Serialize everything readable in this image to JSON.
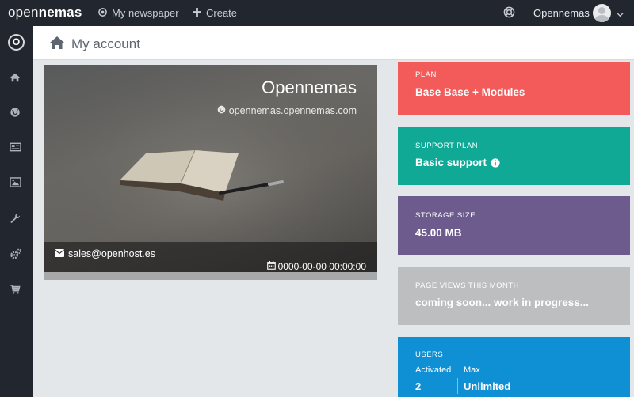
{
  "topbar": {
    "logo_thin": "open",
    "logo_bold": "nemas",
    "nav_newspaper": "My newspaper",
    "nav_create": "Create",
    "user_name": "Opennemas"
  },
  "sidebar": {
    "logo_letter": "O",
    "icons": [
      "home-icon",
      "globe-icon",
      "newspaper-icon",
      "image-icon",
      "wrench-icon",
      "cogs-icon",
      "cart-icon"
    ]
  },
  "header": {
    "title": "My account"
  },
  "hero": {
    "title": "Opennemas",
    "domain": "opennemas.opennemas.com",
    "email": "sales@openhost.es",
    "date": "0000-00-00 00:00:00"
  },
  "cards": {
    "plan": {
      "label": "PLAN",
      "value": "Base Base + Modules",
      "color": "#f35a5a"
    },
    "support": {
      "label": "SUPPORT PLAN",
      "value": "Basic support",
      "color": "#10a996"
    },
    "storage": {
      "label": "STORAGE SIZE",
      "value": "45.00 MB",
      "color": "#6c5b8c"
    },
    "views": {
      "label": "PAGE VIEWS THIS MONTH",
      "value": "coming soon... work in progress...",
      "color": "#bdbebf"
    },
    "users": {
      "label": "USERS",
      "activated_label": "Activated",
      "activated_value": "2",
      "max_label": "Max",
      "max_value": "Unlimited",
      "color": "#0f90d5"
    }
  }
}
